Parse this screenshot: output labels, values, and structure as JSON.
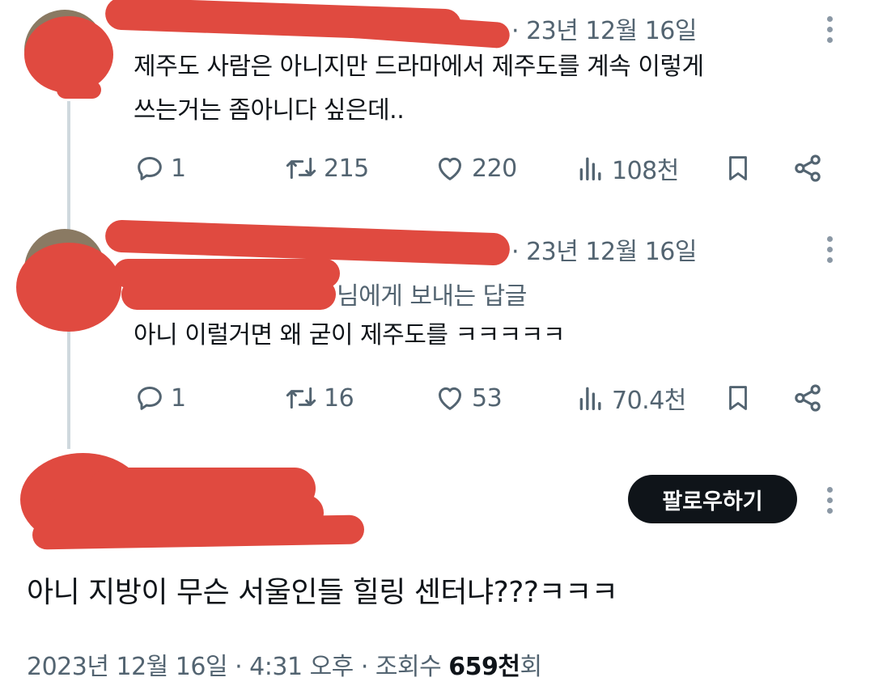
{
  "replies": [
    {
      "date": "· 23년 12월 16일",
      "reply_to": "",
      "text_lines": [
        "제주도 사람은 아니지만 드라마에서 제주도를 계속 이렇게",
        "쓰는거는 좀아니다 싶은데.."
      ],
      "replies_count": "1",
      "reposts": "215",
      "likes": "220",
      "views": "108천"
    },
    {
      "date": "· 23년 12월 16일",
      "reply_to": "님에게 보내는 답글",
      "text_lines": [
        "아니 이럴거면 왜 굳이 제주도를 ㅋㅋㅋㅋㅋ"
      ],
      "replies_count": "1",
      "reposts": "16",
      "likes": "53",
      "views": "70.4천"
    }
  ],
  "main_post": {
    "follow_label": "팔로우하기",
    "text": "아니 지방이 무슨 서울인들 힐링 센터냐???ㅋㅋㅋ",
    "meta_prefix": "2023년 12월 16일 · 4:31 오후 · 조회수 ",
    "views_bold": "659천",
    "views_suffix": "회"
  },
  "icons": [
    "reply-icon",
    "repost-icon",
    "like-icon",
    "views-icon",
    "bookmark-icon",
    "share-icon",
    "more-icon"
  ],
  "colors": {
    "text": "#0f1419",
    "secondary": "#536471",
    "redaction": "#e04a40",
    "button": "#0f1419"
  }
}
